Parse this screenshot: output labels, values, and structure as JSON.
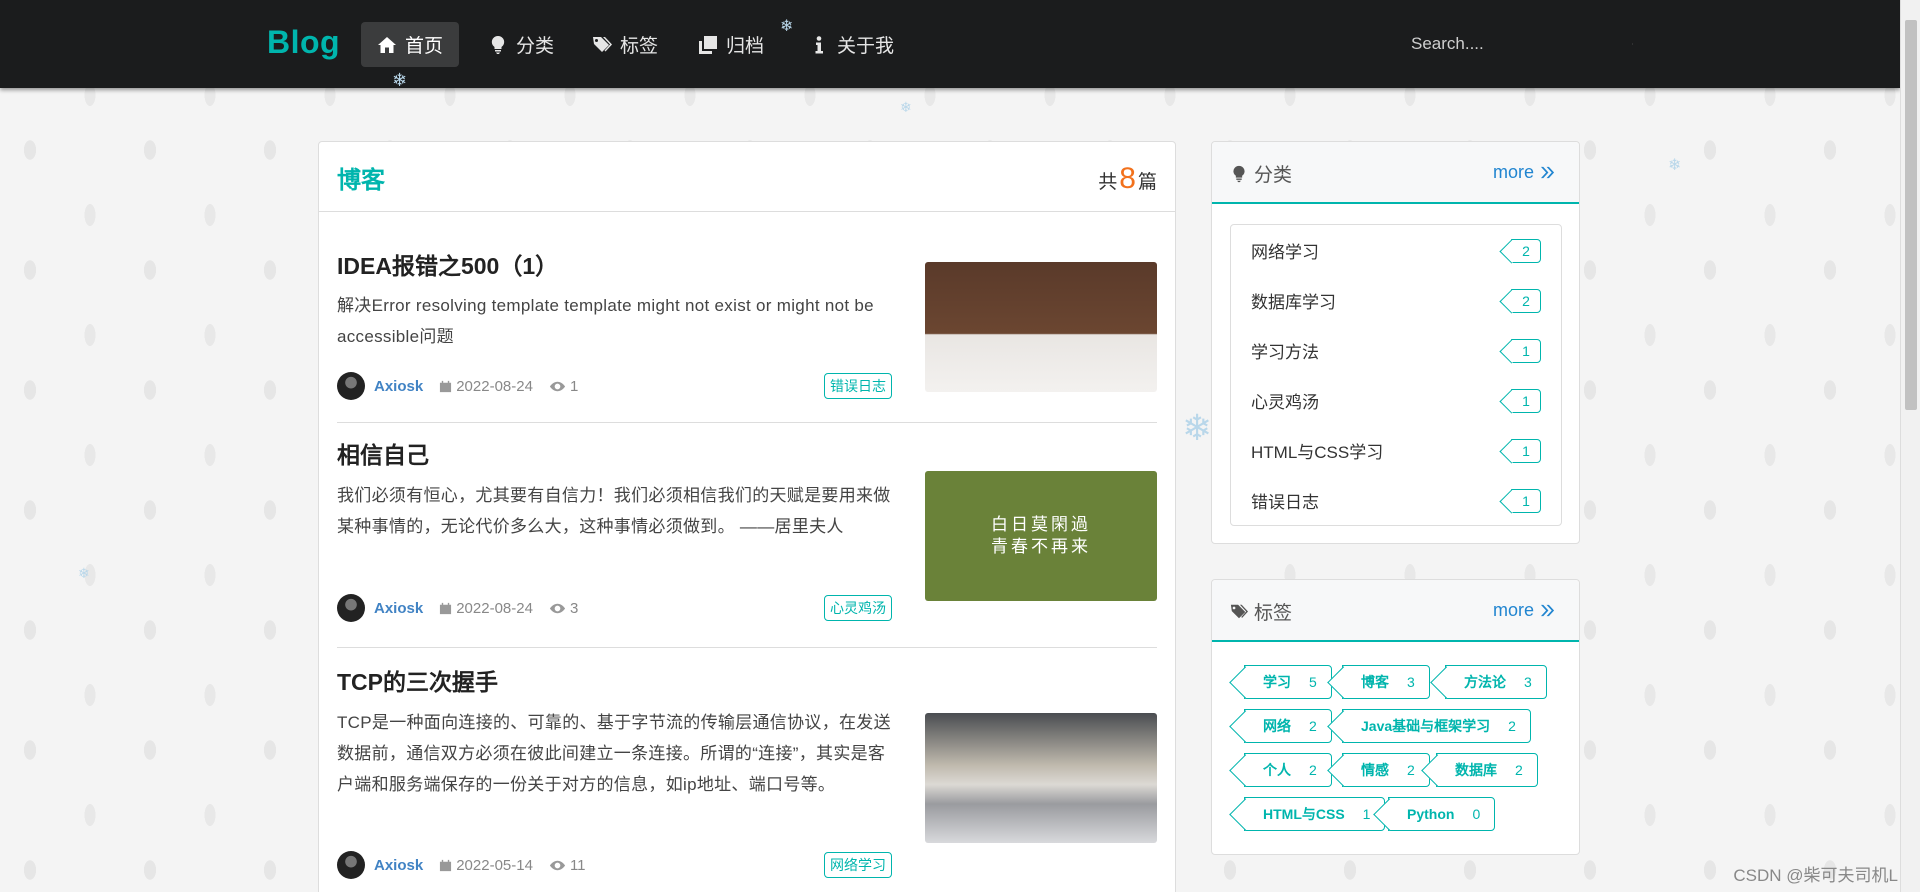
{
  "nav": {
    "brand": "Blog",
    "items": [
      {
        "label": "首页",
        "icon": "home-icon"
      },
      {
        "label": "分类",
        "icon": "lightbulb-icon"
      },
      {
        "label": "标签",
        "icon": "tags-icon"
      },
      {
        "label": "归档",
        "icon": "clone-icon"
      },
      {
        "label": "关于我",
        "icon": "info-icon"
      }
    ],
    "search_placeholder": "Search...."
  },
  "main": {
    "title": "博客",
    "count_prefix": "共",
    "count": "8",
    "count_suffix": "篇",
    "posts": [
      {
        "title": "IDEA报错之500（1）",
        "description": "解决Error resolving template template might not exist or might not be accessible问题",
        "author": "Axiosk",
        "date": "2022-08-24",
        "views": "1",
        "label": "错误日志"
      },
      {
        "title": "相信自己",
        "description": "我们必须有恒心，尤其要有自信力！我们必须相信我们的天赋是要用来做某种事情的，无论代价多么大，这种事情必须做到。 ——居里夫人",
        "author": "Axiosk",
        "date": "2022-08-24",
        "views": "3",
        "label": "心灵鸡汤",
        "image_text_1": "白日莫閑過",
        "image_text_2": "青春不再来"
      },
      {
        "title": "TCP的三次握手",
        "description": "TCP是一种面向连接的、可靠的、基于字节流的传输层通信协议，在发送数据前，通信双方必须在彼此间建立一条连接。所谓的“连接”，其实是客户端和服务端保存的一份关于对方的信息，如ip地址、端口号等。",
        "author": "Axiosk",
        "date": "2022-05-14",
        "views": "11",
        "label": "网络学习"
      }
    ]
  },
  "categories": {
    "title": "分类",
    "more": "more",
    "items": [
      {
        "name": "网络学习",
        "count": "2"
      },
      {
        "name": "数据库学习",
        "count": "2"
      },
      {
        "name": "学习方法",
        "count": "1"
      },
      {
        "name": "心灵鸡汤",
        "count": "1"
      },
      {
        "name": "HTML与CSS学习",
        "count": "1"
      },
      {
        "name": "错误日志",
        "count": "1"
      }
    ]
  },
  "tags": {
    "title": "标签",
    "more": "more",
    "items": [
      {
        "name": "学习",
        "count": "5"
      },
      {
        "name": "博客",
        "count": "3"
      },
      {
        "name": "方法论",
        "count": "3"
      },
      {
        "name": "网络",
        "count": "2"
      },
      {
        "name": "Java基础与框架学习",
        "count": "2"
      },
      {
        "name": "个人",
        "count": "2"
      },
      {
        "name": "情感",
        "count": "2"
      },
      {
        "name": "数据库",
        "count": "2"
      },
      {
        "name": "HTML与CSS",
        "count": "1"
      },
      {
        "name": "Python",
        "count": "0"
      }
    ]
  },
  "watermark": "CSDN @柴可夫司机L",
  "colors": {
    "accent": "#00b5ad",
    "link": "#2185d0",
    "count": "#f2711c",
    "navbar": "#1b1c1d"
  }
}
